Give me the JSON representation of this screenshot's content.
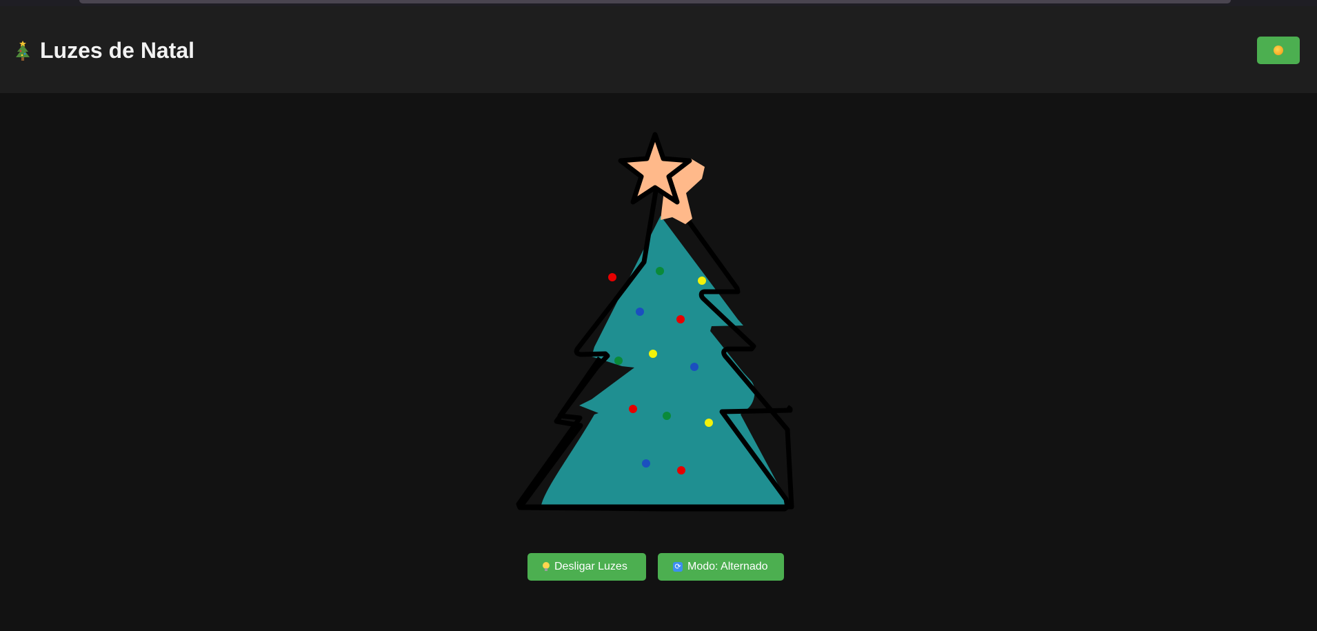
{
  "app": {
    "title": "Luzes de Natal",
    "title_icon": "christmas-tree-icon"
  },
  "header": {
    "theme_toggle_icon": "sun-icon"
  },
  "tree": {
    "star_color": "#ffb98a",
    "tree_color": "#1f8f91",
    "outline_color": "#000000",
    "light_colors": [
      "#e60000",
      "#0a8a3a",
      "#f2f20a",
      "#1b4fbf"
    ]
  },
  "controls": {
    "lights_button": {
      "icon": "light-bulb-icon",
      "label": "Desligar Luzes"
    },
    "mode_button": {
      "icon": "repeat-icon",
      "label": "Modo: Alternado"
    }
  },
  "colors": {
    "background": "#121212",
    "header": "#1e1e1e",
    "accent": "#4caf50"
  }
}
